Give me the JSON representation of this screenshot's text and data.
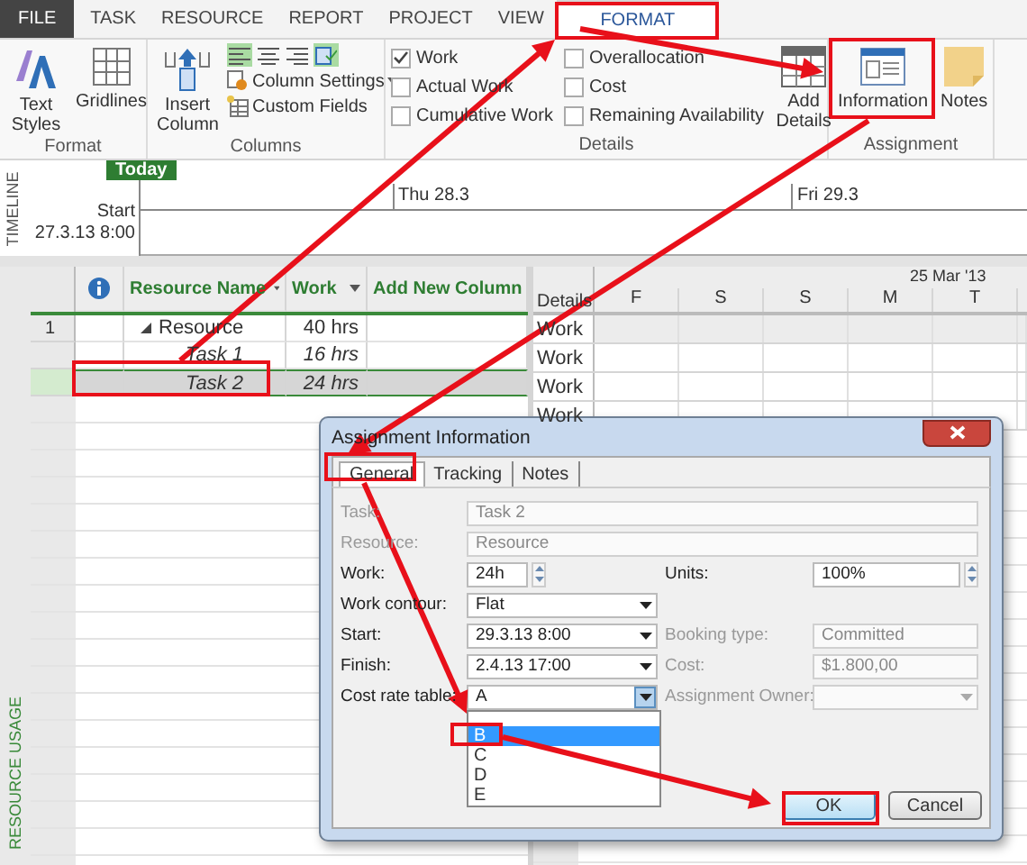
{
  "ribbon_tabs": [
    {
      "label": "FILE",
      "kind": "file",
      "selected": false
    },
    {
      "label": "TASK",
      "kind": "tab",
      "selected": false
    },
    {
      "label": "RESOURCE",
      "kind": "tab",
      "selected": false
    },
    {
      "label": "REPORT",
      "kind": "tab",
      "selected": false
    },
    {
      "label": "PROJECT",
      "kind": "tab",
      "selected": false
    },
    {
      "label": "VIEW",
      "kind": "tab",
      "selected": false
    },
    {
      "label": "FORMAT",
      "kind": "contextual",
      "selected": true
    }
  ],
  "ribbon": {
    "format": {
      "label": "Format",
      "buttons": [
        "Text Styles",
        "Gridlines"
      ]
    },
    "columns": {
      "label": "Columns",
      "insert": "Insert Column",
      "toggles": [
        {
          "on": true
        },
        {
          "on": false
        },
        {
          "on": false
        },
        {
          "on": true
        }
      ],
      "commands": [
        "Column Settings",
        "Custom Fields"
      ]
    },
    "details": {
      "label": "Details",
      "checkboxes": [
        {
          "label": "Work",
          "checked": true
        },
        {
          "label": "Actual Work",
          "checked": false
        },
        {
          "label": "Cumulative Work",
          "checked": false
        },
        {
          "label": "Overallocation",
          "checked": false
        },
        {
          "label": "Cost",
          "checked": false
        },
        {
          "label": "Remaining Availability",
          "checked": false
        }
      ],
      "button": "Add Details"
    },
    "assignment": {
      "label": "Assignment",
      "buttons": [
        "Information",
        "Notes"
      ]
    }
  },
  "timeline": {
    "label": "TIMELINE",
    "today": "Today",
    "start_label": "Start",
    "start_date": "27.3.13 8:00",
    "ticks": [
      "Thu 28.3",
      "Fri 29.3"
    ]
  },
  "sheet": {
    "view_label": "RESOURCE USAGE",
    "columns": [
      "Resource Name",
      "Work",
      "Add New Column"
    ],
    "rows": [
      {
        "kind": "resource",
        "number": "1",
        "name": "Resource",
        "work": "40 hrs",
        "expanded": true,
        "selected": false
      },
      {
        "kind": "assignment",
        "name": "Task 1",
        "work": "16 hrs",
        "selected": false
      },
      {
        "kind": "assignment",
        "name": "Task 2",
        "work": "24 hrs",
        "selected": true
      }
    ]
  },
  "timescale": {
    "details_heading": "Details",
    "week": "25 Mar '13",
    "days": [
      "F",
      "S",
      "S",
      "M",
      "T"
    ],
    "rows": [
      "Work",
      "Work",
      "Work",
      "Work"
    ]
  },
  "dialog": {
    "title": "Assignment Information",
    "tabs": [
      {
        "label": "General",
        "selected": true
      },
      {
        "label": "Tracking",
        "selected": false
      },
      {
        "label": "Notes",
        "selected": false
      }
    ],
    "rows": [
      [
        {
          "label": "Task:",
          "value": "Task 2",
          "kind": "text",
          "disabled": true,
          "wide": true
        }
      ],
      [
        {
          "label": "Resource:",
          "value": "Resource",
          "kind": "text",
          "disabled": true,
          "wide": true
        }
      ],
      [
        {
          "label": "Work:",
          "value": "24h",
          "kind": "spin",
          "disabled": false
        },
        {
          "label": "Units:",
          "value": "100%",
          "kind": "spin",
          "disabled": false
        }
      ],
      [
        {
          "label": "Work contour:",
          "value": "Flat",
          "kind": "dropdown",
          "disabled": false
        }
      ],
      [
        {
          "label": "Start:",
          "value": "29.3.13 8:00",
          "kind": "dropdown",
          "disabled": false
        },
        {
          "label": "Booking type:",
          "value": "Committed",
          "kind": "text",
          "disabled": true
        }
      ],
      [
        {
          "label": "Finish:",
          "value": "2.4.13 17:00",
          "kind": "dropdown",
          "disabled": false
        },
        {
          "label": "Cost:",
          "value": "$1.800,00",
          "kind": "text",
          "disabled": true
        }
      ],
      [
        {
          "label": "Cost rate table:",
          "value": "A",
          "kind": "dropdown",
          "disabled": false,
          "open": true
        },
        {
          "label": "Assignment Owner:",
          "kind": "dropdown",
          "disabled": true
        }
      ]
    ],
    "options": [
      {
        "label": "B",
        "selected": true
      },
      {
        "label": "C",
        "selected": false
      },
      {
        "label": "D",
        "selected": false
      },
      {
        "label": "E",
        "selected": false
      }
    ],
    "buttons": [
      {
        "label": "OK",
        "kind": "default"
      },
      {
        "label": "Cancel",
        "kind": "normal"
      }
    ]
  }
}
